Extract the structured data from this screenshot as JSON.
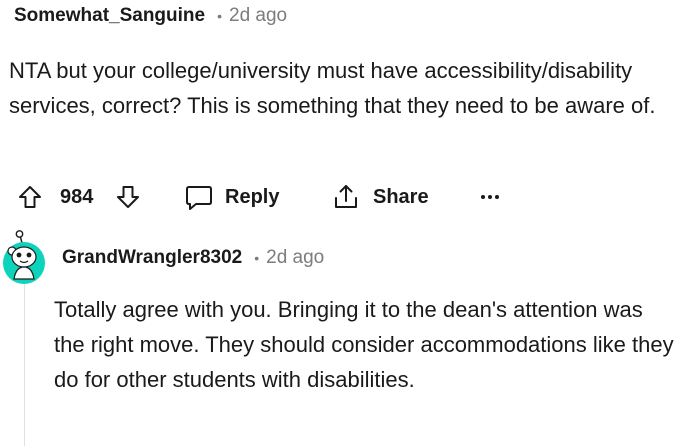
{
  "comment": {
    "username": "Somewhat_Sanguine",
    "separator": "•",
    "timestamp": "2d ago",
    "body": "NTA but your college/university must have accessibility/disability services, correct? This is something that they need to be aware of.",
    "score": "984",
    "actions": {
      "upvote_icon": "arrow-up-icon",
      "downvote_icon": "arrow-down-icon",
      "reply_label": "Reply",
      "reply_icon": "speech-bubble-icon",
      "share_label": "Share",
      "share_icon": "share-upload-icon",
      "more_label": "•••"
    }
  },
  "reply": {
    "username": "GrandWrangler8302",
    "separator": "•",
    "timestamp": "2d ago",
    "avatar_icon": "snoo-avatar-icon",
    "avatar_color": "#0dd3bb",
    "body": "Totally agree with you. Bringing it to the dean's attention was the right move. They should consider accommodations like they do for other students with disabilities."
  }
}
